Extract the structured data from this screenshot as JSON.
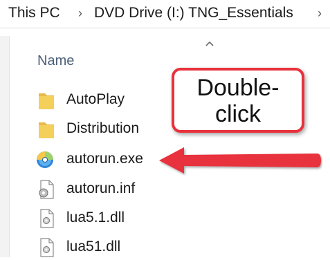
{
  "breadcrumb": {
    "items": [
      "This PC",
      "DVD Drive (I:) TNG_Essentials"
    ],
    "separator": "›"
  },
  "column_header": {
    "name_label": "Name"
  },
  "files": [
    {
      "name": "AutoPlay",
      "icon": "folder-icon"
    },
    {
      "name": "Distribution",
      "icon": "folder-icon"
    },
    {
      "name": "autorun.exe",
      "icon": "disc-app-icon"
    },
    {
      "name": "autorun.inf",
      "icon": "settings-file-icon"
    },
    {
      "name": "lua5.1.dll",
      "icon": "dll-file-icon"
    },
    {
      "name": "lua51.dll",
      "icon": "dll-file-icon"
    }
  ],
  "callout": {
    "line1": "Double-",
    "line2": "click"
  },
  "colors": {
    "callout_red": "#e8323c",
    "folder_yellow": "#f4cf5a",
    "header_text": "#4c607a"
  }
}
